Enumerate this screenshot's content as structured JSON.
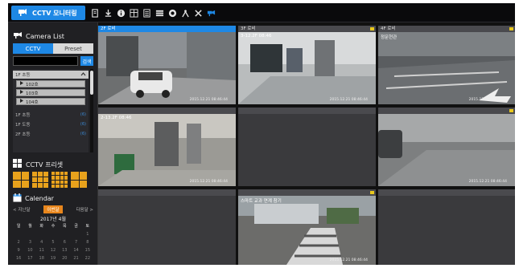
{
  "header": {
    "monitor_tab_label": "CCTV 모니터링",
    "toolbar_icons": [
      "document-icon",
      "download-icon",
      "info-icon",
      "grid-icon",
      "list-icon",
      "stack-icon",
      "record-icon",
      "wrench-icon",
      "tools-icon",
      "camera-icon"
    ]
  },
  "sidebar": {
    "camera_list_title": "Camera List",
    "tabs": [
      {
        "label": "CCTV",
        "active": true
      },
      {
        "label": "Preset",
        "active": false
      }
    ],
    "search": {
      "value": "",
      "button_label": "검색"
    },
    "tree": {
      "expanded_floor": {
        "label": "1F 초등",
        "count": ""
      },
      "cameras": [
        "102호",
        "103호",
        "104호"
      ],
      "floors": [
        {
          "label": "1F 초등",
          "count": "(6)"
        },
        {
          "label": "1F 도동",
          "count": "(6)"
        },
        {
          "label": "2F 초등",
          "count": "(6)"
        }
      ]
    },
    "preset_title": "CCTV 프리셋",
    "calendar": {
      "title": "Calendar",
      "prev_label": "< 지난달",
      "current_label": "이번달",
      "next_label": "다음달 >",
      "month_label": "2017년 4월",
      "weekdays": [
        "일",
        "월",
        "화",
        "수",
        "목",
        "금",
        "토"
      ],
      "weeks": [
        [
          "",
          "",
          "",
          "",
          "",
          "",
          "1"
        ],
        [
          "2",
          "3",
          "4",
          "5",
          "6",
          "7",
          "8"
        ],
        [
          "9",
          "10",
          "11",
          "12",
          "13",
          "14",
          "15"
        ],
        [
          "16",
          "17",
          "18",
          "19",
          "20",
          "21",
          "22"
        ]
      ]
    }
  },
  "cameras": [
    {
      "title": "2F 로비",
      "overlay": "",
      "timestamp": "2015.12.21 08:46:44",
      "selected": true,
      "live": false
    },
    {
      "title": "3F 로비",
      "overlay": "3-12.2F 08:46",
      "timestamp": "2015.12.21 08:46:44",
      "selected": false,
      "live": true
    },
    {
      "title": "4F 로비",
      "overlay": "정문현관",
      "timestamp": "2015.12.21 08:46:44",
      "selected": false,
      "live": true
    },
    {
      "title": "",
      "overlay": "2-13.2F 08:46",
      "timestamp": "2015.12.21 08:46:44",
      "selected": false,
      "live": false
    },
    {
      "title": "",
      "overlay": "",
      "timestamp": "",
      "selected": false,
      "live": false
    },
    {
      "title": "",
      "overlay": "",
      "timestamp": "2015.12.21 08:46:44",
      "selected": false,
      "live": true
    },
    {
      "title": "",
      "overlay": "",
      "timestamp": "",
      "selected": false,
      "live": false
    },
    {
      "title": "",
      "overlay": "스마트 교과 연계 참기",
      "timestamp": "2015.12.21 08:46:44",
      "selected": false,
      "live": true
    },
    {
      "title": "",
      "overlay": "",
      "timestamp": "",
      "selected": false,
      "live": false
    }
  ],
  "colors": {
    "accent": "#1e88e5",
    "preset": "#e8a21c",
    "live_marker": "#e8c81c"
  }
}
